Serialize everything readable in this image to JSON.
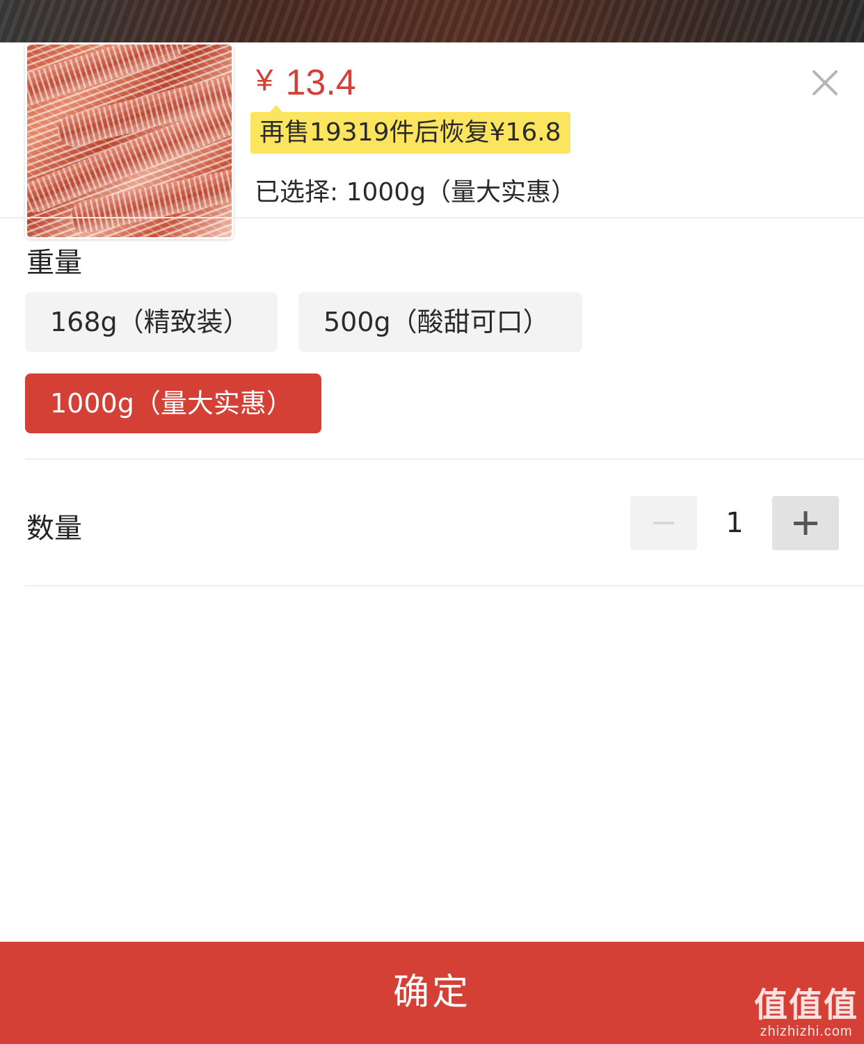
{
  "product": {
    "price_symbol": "¥",
    "price": "13.4",
    "promo_note": "再售19319件后恢复¥16.8",
    "selected_label": "已选择: 1000g（量大实惠）"
  },
  "weight": {
    "title": "重量",
    "options": [
      {
        "label": "168g（精致装）",
        "selected": false
      },
      {
        "label": "500g（酸甜可口）",
        "selected": false
      },
      {
        "label": "1000g（量大实惠）",
        "selected": true
      }
    ]
  },
  "quantity": {
    "title": "数量",
    "value": "1"
  },
  "confirm_label": "确定",
  "watermark": {
    "brand": "值值值",
    "domain": "zhizhizhi.com"
  },
  "colors": {
    "accent": "#d44035",
    "promo_bg": "#fbe45e",
    "option_bg": "#f3f3f3"
  },
  "icons": [
    "close-icon",
    "minus-icon",
    "plus-icon"
  ]
}
